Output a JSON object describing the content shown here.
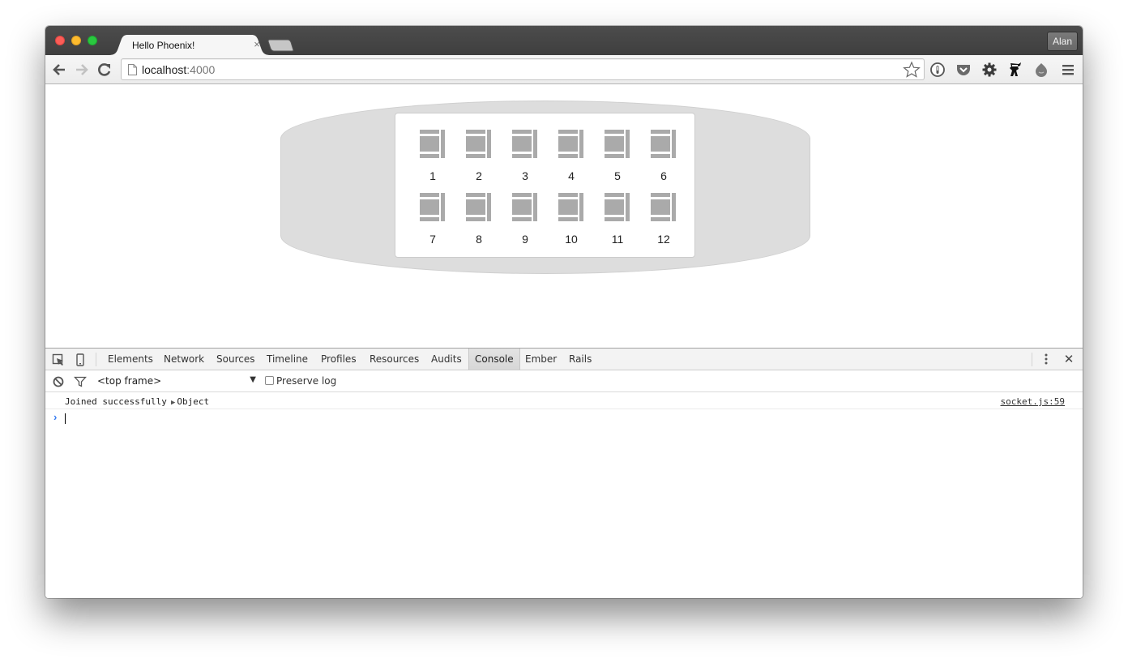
{
  "browser": {
    "tab": {
      "title": "Hello Phoenix!",
      "close_glyph": "×"
    },
    "profile": "Alan",
    "address": {
      "host": "localhost",
      "port": ":4000"
    },
    "extensions": [
      "1password-icon",
      "pocket-icon",
      "settings-gear-icon",
      "ninja-extension-icon",
      "blob-extension-icon",
      "menu-icon"
    ]
  },
  "page": {
    "seats": [
      {
        "number": "1"
      },
      {
        "number": "2"
      },
      {
        "number": "3"
      },
      {
        "number": "4"
      },
      {
        "number": "5"
      },
      {
        "number": "6"
      },
      {
        "number": "7"
      },
      {
        "number": "8"
      },
      {
        "number": "9"
      },
      {
        "number": "10"
      },
      {
        "number": "11"
      },
      {
        "number": "12"
      }
    ],
    "colors": {
      "fuselage": "#dddddd",
      "seat": "#aaaaaa",
      "cabin": "#ffffff"
    }
  },
  "devtools": {
    "tabs": [
      {
        "label": "Elements"
      },
      {
        "label": "Network"
      },
      {
        "label": "Sources"
      },
      {
        "label": "Timeline"
      },
      {
        "label": "Profiles"
      },
      {
        "label": "Resources"
      },
      {
        "label": "Audits"
      },
      {
        "label": "Console",
        "active": true
      },
      {
        "label": "Ember"
      },
      {
        "label": "Rails"
      }
    ],
    "console": {
      "frame": "<top frame>",
      "preserve_log_label": "Preserve log",
      "preserve_log_checked": false,
      "messages": [
        {
          "text": "Joined successfully",
          "object": "Object",
          "source": "socket.js:59"
        }
      ],
      "prompt_glyph": "›"
    }
  }
}
